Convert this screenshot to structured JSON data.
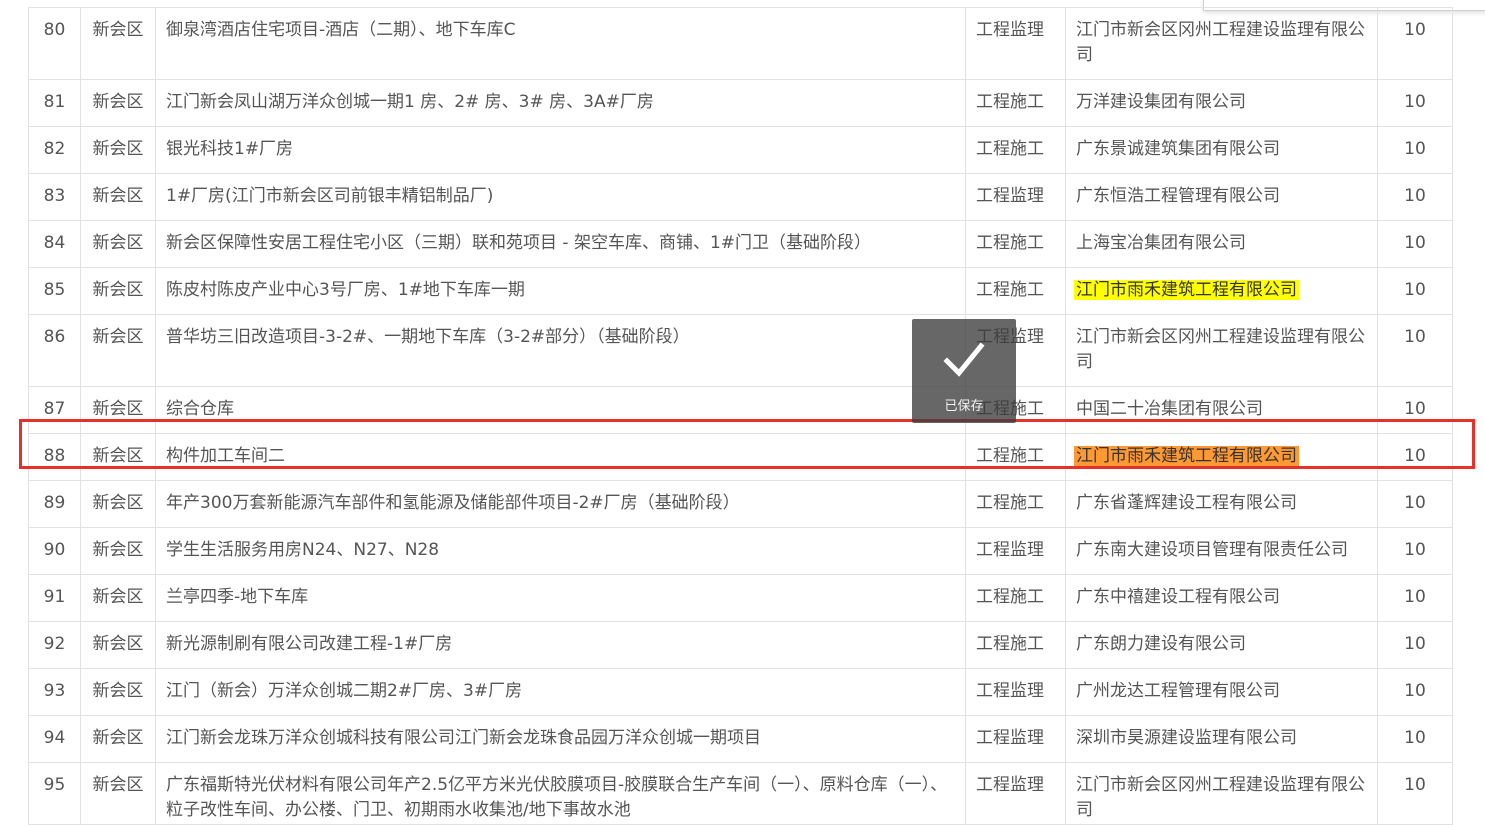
{
  "rows": [
    {
      "no": "80",
      "district": "新会区",
      "project": "御泉湾酒店住宅项目-酒店（二期）、地下车库C",
      "type": "工程监理",
      "company": "江门市新会区冈州工程建设监理有限公司",
      "score": "10"
    },
    {
      "no": "81",
      "district": "新会区",
      "project": "江门新会凤山湖万洋众创城一期1 房、2# 房、3# 房、3A#厂房",
      "type": "工程施工",
      "company": "万洋建设集团有限公司",
      "score": "10"
    },
    {
      "no": "82",
      "district": "新会区",
      "project": "银光科技1#厂房",
      "type": "工程施工",
      "company": "广东景诚建筑集团有限公司",
      "score": "10"
    },
    {
      "no": "83",
      "district": "新会区",
      "project": "1#厂房(江门市新会区司前银丰精铝制品厂)",
      "type": "工程监理",
      "company": "广东恒浩工程管理有限公司",
      "score": "10"
    },
    {
      "no": "84",
      "district": "新会区",
      "project": "新会区保障性安居工程住宅小区（三期）联和苑项目 - 架空车库、商铺、1#门卫（基础阶段）",
      "type": "工程施工",
      "company": "上海宝冶集团有限公司",
      "score": "10"
    },
    {
      "no": "85",
      "district": "新会区",
      "project": "陈皮村陈皮产业中心3号厂房、1#地下车库一期",
      "type": "工程施工",
      "company": "江门市雨禾建筑工程有限公司",
      "score": "10"
    },
    {
      "no": "86",
      "district": "新会区",
      "project": "普华坊三旧改造项目-3-2#、一期地下车库（3-2#部分）（基础阶段）",
      "type": "工程监理",
      "company": "江门市新会区冈州工程建设监理有限公司",
      "score": "10"
    },
    {
      "no": "87",
      "district": "新会区",
      "project": "综合仓库",
      "type": "工程施工",
      "company": "中国二十冶集团有限公司",
      "score": "10"
    },
    {
      "no": "88",
      "district": "新会区",
      "project": "构件加工车间二",
      "type": "工程施工",
      "company": "江门市雨禾建筑工程有限公司",
      "score": "10"
    },
    {
      "no": "89",
      "district": "新会区",
      "project": "年产300万套新能源汽车部件和氢能源及储能部件项目-2#厂房（基础阶段）",
      "type": "工程施工",
      "company": "广东省蓬辉建设工程有限公司",
      "score": "10"
    },
    {
      "no": "90",
      "district": "新会区",
      "project": "学生生活服务用房N24、N27、N28",
      "type": "工程监理",
      "company": "广东南大建设项目管理有限责任公司",
      "score": "10"
    },
    {
      "no": "91",
      "district": "新会区",
      "project": "兰亭四季-地下车库",
      "type": "工程施工",
      "company": "广东中禧建设工程有限公司",
      "score": "10"
    },
    {
      "no": "92",
      "district": "新会区",
      "project": "新光源制刷有限公司改建工程-1#厂房",
      "type": "工程施工",
      "company": "广东朗力建设有限公司",
      "score": "10"
    },
    {
      "no": "93",
      "district": "新会区",
      "project": "江门（新会）万洋众创城二期2#厂房、3#厂房",
      "type": "工程监理",
      "company": "广州龙达工程管理有限公司",
      "score": "10"
    },
    {
      "no": "94",
      "district": "新会区",
      "project": "江门新会龙珠万洋众创城科技有限公司江门新会龙珠食品园万洋众创城一期项目",
      "type": "工程监理",
      "company": "深圳市昊源建设监理有限公司",
      "score": "10"
    },
    {
      "no": "95",
      "district": "新会区",
      "project": "广东福斯特光伏材料有限公司年产2.5亿平方米光伏胶膜项目-胶膜联合生产车间（一）、原料仓库（一）、粒子改性车间、办公楼、门卫、初期雨水收集池/地下事故水池",
      "type": "工程监理",
      "company": "江门市新会区冈州工程建设监理有限公司",
      "score": "10"
    }
  ],
  "highlights": {
    "yellow": "#ffff00",
    "orange": "#ff9933",
    "selection_border": "#e8302a"
  },
  "toast": {
    "text": "已保存",
    "icon": "checkmark-icon"
  }
}
